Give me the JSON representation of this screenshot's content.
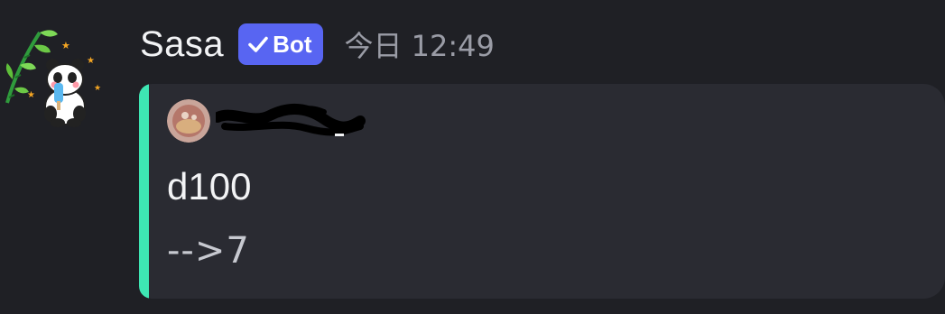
{
  "message": {
    "username": "Sasa",
    "bot_tag": "Bot",
    "timestamp": "今日 12:49",
    "avatar_icon": "panda-with-bamboo-icon"
  },
  "embed": {
    "accent_color": "#3ee6b3",
    "author_icon": "user-avatar-icon",
    "title": "d100",
    "description": "-->7"
  },
  "colors": {
    "background": "#1f2025",
    "embed_background": "#2a2b32",
    "bot_tag": "#5865f2",
    "username": "#f2f3f5",
    "timestamp": "#9a9ca6"
  }
}
